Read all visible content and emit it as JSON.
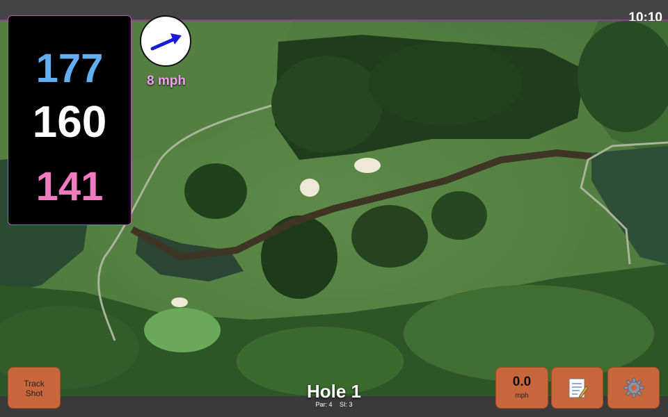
{
  "clock": "10:10",
  "yardages": {
    "back": "177",
    "middle": "160",
    "front": "141"
  },
  "wind": {
    "speed_label": "8 mph",
    "direction_icon": "arrow-up-right-icon"
  },
  "buttons": {
    "track_shot": "Track\nShot",
    "speed_value": "0.0",
    "speed_unit": "mph",
    "notes_icon": "notepad-icon",
    "settings_icon": "gear-icon"
  },
  "hole": {
    "title": "Hole 1",
    "par": "Par: 4",
    "si": "SI: 3"
  },
  "colors": {
    "back": "#61aef0",
    "middle": "#ffffff",
    "front": "#f07ac0",
    "button": "#c8663c",
    "wind_text": "#f2a0f0",
    "accent": "#8a3f8f"
  }
}
